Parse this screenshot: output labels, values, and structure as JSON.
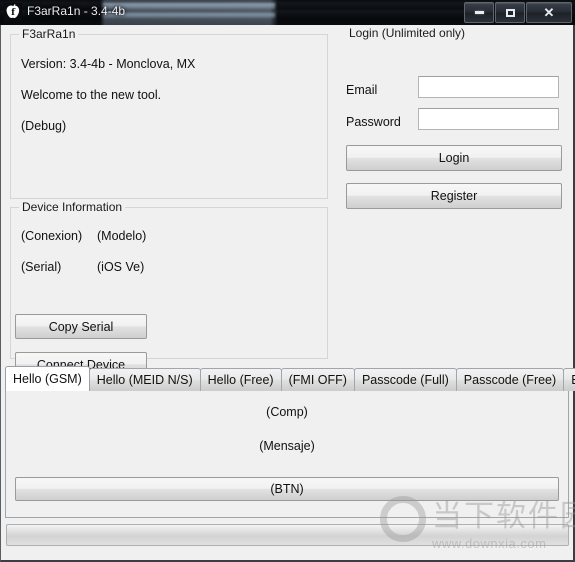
{
  "window": {
    "title": "F3arRa1n - 3.4-4b",
    "icon": "apple-f-icon",
    "controls": {
      "minimize": "minimize-icon",
      "maximize": "maximize-icon",
      "close": "✕"
    }
  },
  "info_group": {
    "title": "F3arRa1n",
    "lines": [
      "Version: 3.4-4b - Monclova, MX",
      "Welcome to the new tool.",
      "(Debug)"
    ]
  },
  "login_group": {
    "title": "Login (Unlimited only)",
    "email_label": "Email",
    "email_value": "",
    "email_placeholder": "",
    "password_label": "Password",
    "password_value": "",
    "password_placeholder": "",
    "login_button": "Login",
    "register_button": "Register"
  },
  "device_group": {
    "title": "Device Information",
    "connection": "(Conexion)",
    "model": "(Modelo)",
    "serial": "(Serial)",
    "ios_version": "(iOS Ve)",
    "copy_serial_button": "Copy Serial",
    "connect_device_button": "Connect Device"
  },
  "tabs": [
    {
      "label": "Hello (GSM)",
      "active": true
    },
    {
      "label": "Hello (MEID N/S)",
      "active": false
    },
    {
      "label": "Hello (Free)",
      "active": false
    },
    {
      "label": "(FMI OFF)",
      "active": false
    },
    {
      "label": "Passcode (Full)",
      "active": false
    },
    {
      "label": "Passcode (Free)",
      "active": false
    },
    {
      "label": "Extras",
      "active": false
    }
  ],
  "tab_page": {
    "compatibility": "(Comp)",
    "message": "(Mensaje)",
    "action_button": "(BTN)"
  },
  "progress": {
    "value": 0
  },
  "watermark": {
    "site_name": "当下软件园",
    "url": "www.downxia.com"
  },
  "colors": {
    "window_background": "#f0f0f0",
    "titlebar": "#101317",
    "groupbox_border": "#d5d5d5",
    "text": "#111111",
    "active_tab": "#ffffff"
  }
}
